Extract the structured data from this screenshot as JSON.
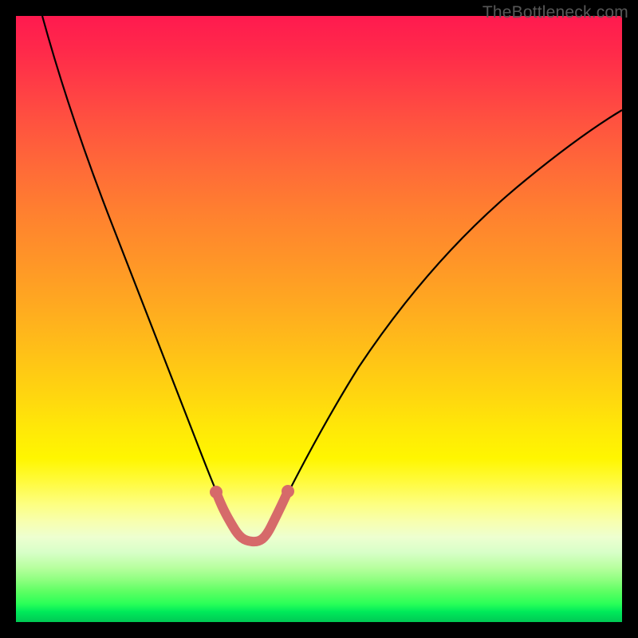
{
  "watermark": "TheBottleneck.com",
  "colors": {
    "frame": "#000000",
    "curve_main": "#000000",
    "curve_highlight": "#d66a6a"
  },
  "chart_data": {
    "type": "line",
    "title": "",
    "xlabel": "",
    "ylabel": "",
    "xlim": [
      0,
      100
    ],
    "ylim": [
      0,
      100
    ],
    "series": [
      {
        "name": "bottleneck-curve",
        "x": [
          4,
          8,
          12,
          16,
          20,
          24,
          28,
          32,
          34.5,
          36.5,
          38.5,
          40.5,
          42.5,
          46,
          50,
          56,
          63,
          70,
          78,
          86,
          94,
          100
        ],
        "y": [
          100,
          88,
          76,
          64,
          53,
          42,
          31,
          21,
          15,
          13,
          12.8,
          13,
          15,
          21,
          28,
          37,
          46,
          54,
          62,
          70,
          77,
          82
        ]
      }
    ],
    "annotations": [
      {
        "name": "highlight-segment-range",
        "x_start": 32,
        "x_end": 46,
        "style": "thick-salmon",
        "endpoints": "dots"
      }
    ]
  }
}
